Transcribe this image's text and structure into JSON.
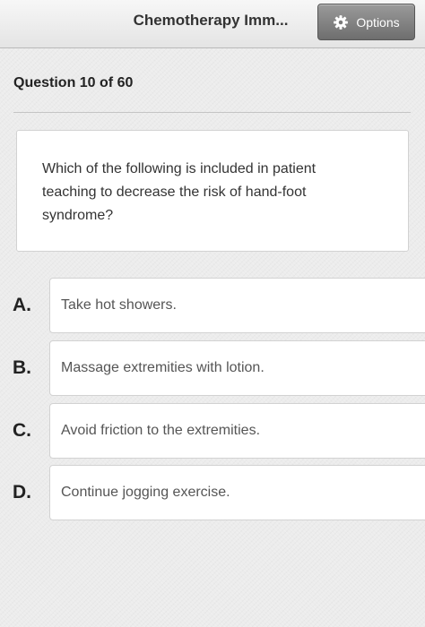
{
  "header": {
    "title": "Chemotherapy Imm...",
    "options_label": "Options",
    "options_icon": "gear-icon"
  },
  "quiz": {
    "counter": "Question 10 of 60",
    "question": "Which of the following is included in patient teaching to decrease the risk of hand-foot syndrome?",
    "answers": [
      {
        "letter": "A.",
        "text": "Take hot showers."
      },
      {
        "letter": "B.",
        "text": "Massage extremities with lotion."
      },
      {
        "letter": "C.",
        "text": "Avoid friction to the extremities."
      },
      {
        "letter": "D.",
        "text": "Continue jogging exercise."
      }
    ]
  },
  "colors": {
    "background": "#ececec",
    "card": "#ffffff",
    "options_button": "#7f7f7f"
  }
}
